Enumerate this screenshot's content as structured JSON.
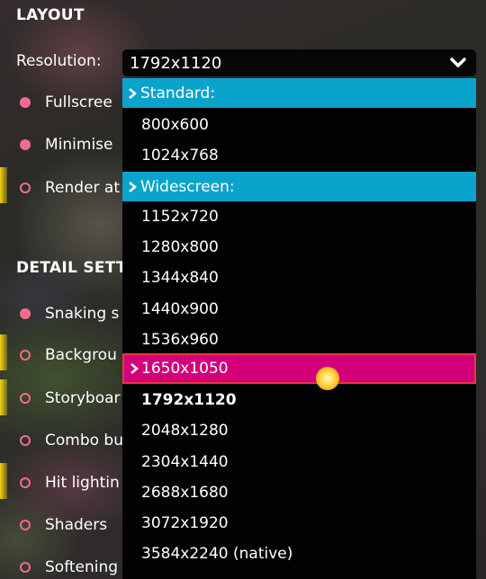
{
  "sections": {
    "layout_title": "LAYOUT",
    "detail_title": "DETAIL SETTI"
  },
  "resolution": {
    "label": "Resolution:",
    "current_value": "1792x1120"
  },
  "layout_options": [
    {
      "label": "Fullscree",
      "checked": true
    },
    {
      "label": "Minimise",
      "checked": true
    },
    {
      "label": "Render at",
      "checked": false
    }
  ],
  "detail_options": [
    {
      "label": "Snaking s",
      "checked": true
    },
    {
      "label": "Backgrou",
      "checked": false
    },
    {
      "label": "Storyboar",
      "checked": false
    },
    {
      "label": "Combo bu",
      "checked": false
    },
    {
      "label": "Hit lightin",
      "checked": false
    },
    {
      "label": "Shaders",
      "checked": false
    },
    {
      "label": "Softening",
      "checked": false
    }
  ],
  "dropdown": {
    "groups": [
      {
        "header": "Standard:",
        "items": [
          "800x600",
          "1024x768"
        ]
      },
      {
        "header": "Widescreen:",
        "items": [
          "1152x720",
          "1280x800",
          "1344x840",
          "1440x900",
          "1536x960",
          "1650x1050",
          "1792x1120",
          "2048x1280",
          "2304x1440",
          "2688x1680",
          "3072x1920",
          "3584x2240 (native)"
        ]
      }
    ],
    "hovered": "1650x1050",
    "selected": "1792x1120"
  },
  "icons": {
    "dropdown_chevron": "chevron-down-icon",
    "group_caret": "caret-right-icon"
  },
  "colors": {
    "accent_pink": "#f26d8c",
    "group_header": "#0aa3cc",
    "hover_item": "#d4007a",
    "hover_border": "#e8383d",
    "dropdown_bg": "#020202"
  }
}
